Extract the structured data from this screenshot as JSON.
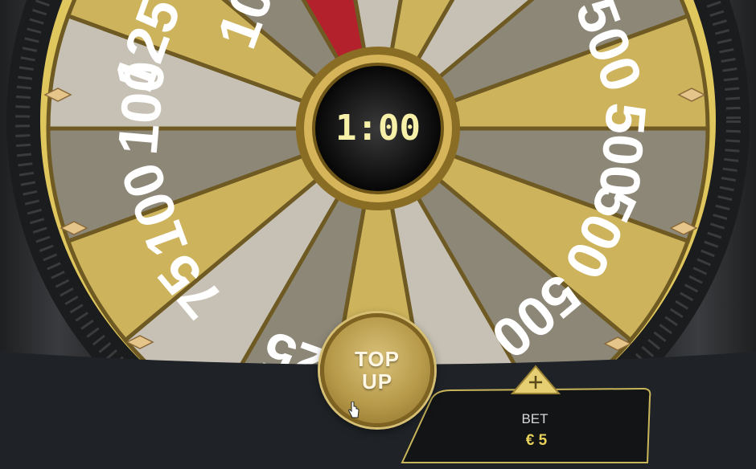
{
  "wheel": {
    "timer": "1:00",
    "segment_labels": [
      "125",
      "100",
      "100",
      "75",
      "25",
      "25",
      "500",
      "500",
      "500",
      "500"
    ],
    "visible_fragment_top": "10"
  },
  "controls": {
    "topup_line1": "TOP",
    "topup_line2": "UP",
    "bet_label": "BET",
    "bet_value": "€ 5",
    "plus_icon": "plus-icon"
  },
  "colors": {
    "gold": "#c9aa52",
    "gray": "#8a8679",
    "red": "#b3222c",
    "accent": "#e8d25a"
  }
}
